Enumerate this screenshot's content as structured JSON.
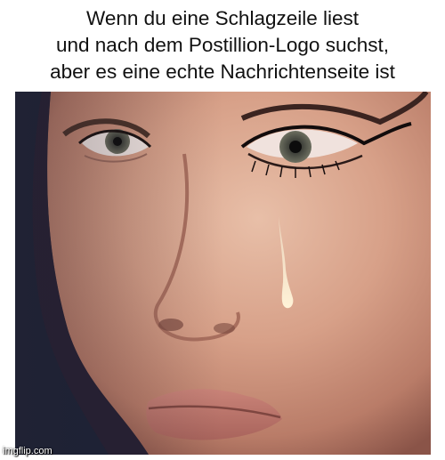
{
  "caption": {
    "lines": [
      "Wenn du eine Schlagzeile liest",
      "und nach dem Postillion-Logo suchst,",
      "aber es eine echte Nachrichtenseite ist"
    ]
  },
  "photo": {
    "subject": "close-up face with tear"
  },
  "watermark": {
    "text": "imgflip.com"
  },
  "colors": {
    "background": "#ffffff",
    "caption_text": "#111111",
    "photo_backdrop": "#1b2236",
    "skin": "#d8a48e",
    "tear": "#e9d9b4"
  }
}
